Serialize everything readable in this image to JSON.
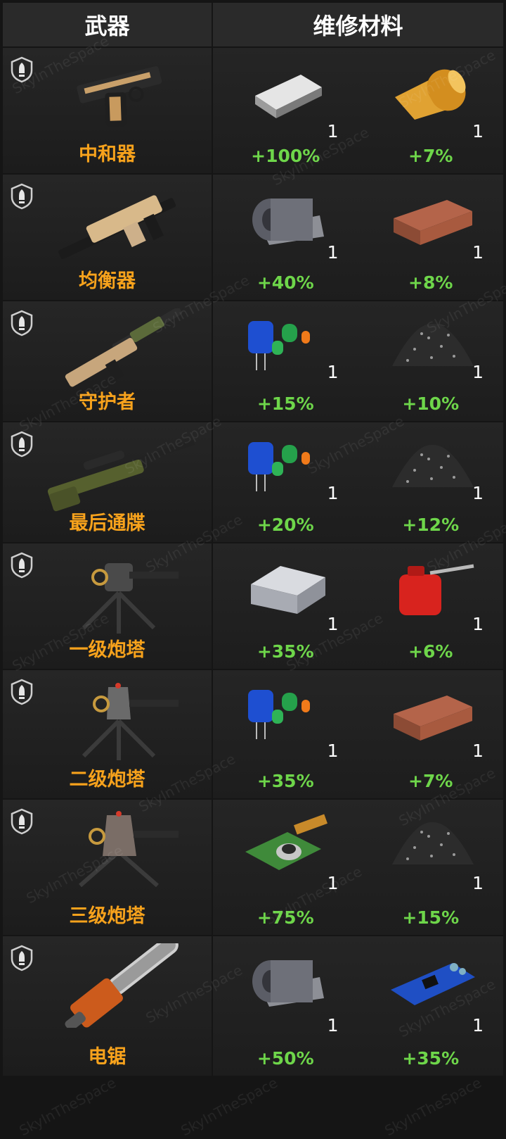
{
  "header": {
    "weapon": "武器",
    "materials": "维修材料"
  },
  "watermark": "SkyInTheSpace",
  "colors": {
    "weapon_name": "#f7a21c",
    "percent": "#6ed64a"
  },
  "rows": [
    {
      "weapon": "中和器",
      "weapon_icon": "pistol-icon",
      "left": {
        "icon": "steel-ingot-icon",
        "qty": "1",
        "pct": "+100%"
      },
      "right": {
        "icon": "gold-foil-roll-icon",
        "qty": "1",
        "pct": "+7%"
      }
    },
    {
      "weapon": "均衡器",
      "weapon_icon": "smg-icon",
      "left": {
        "icon": "metal-sheet-roll-icon",
        "qty": "1",
        "pct": "+40%"
      },
      "right": {
        "icon": "copper-brick-icon",
        "qty": "1",
        "pct": "+8%"
      }
    },
    {
      "weapon": "守护者",
      "weapon_icon": "shotgun-icon",
      "left": {
        "icon": "capacitors-icon",
        "qty": "1",
        "pct": "+15%"
      },
      "right": {
        "icon": "gravel-pile-icon",
        "qty": "1",
        "pct": "+10%"
      }
    },
    {
      "weapon": "最后通牒",
      "weapon_icon": "sniper-rifle-icon",
      "left": {
        "icon": "capacitors-icon",
        "qty": "1",
        "pct": "+20%"
      },
      "right": {
        "icon": "gravel-pile-icon",
        "qty": "1",
        "pct": "+12%"
      }
    },
    {
      "weapon": "一级炮塔",
      "weapon_icon": "turret-lv1-icon",
      "left": {
        "icon": "aluminum-block-icon",
        "qty": "1",
        "pct": "+35%"
      },
      "right": {
        "icon": "oil-can-icon",
        "qty": "1",
        "pct": "+6%"
      }
    },
    {
      "weapon": "二级炮塔",
      "weapon_icon": "turret-lv2-icon",
      "left": {
        "icon": "capacitors-icon",
        "qty": "1",
        "pct": "+35%"
      },
      "right": {
        "icon": "copper-brick-icon",
        "qty": "1",
        "pct": "+7%"
      }
    },
    {
      "weapon": "三级炮塔",
      "weapon_icon": "turret-lv3-icon",
      "left": {
        "icon": "camera-module-icon",
        "qty": "1",
        "pct": "+75%"
      },
      "right": {
        "icon": "gravel-pile-icon",
        "qty": "1",
        "pct": "+15%"
      }
    },
    {
      "weapon": "电锯",
      "weapon_icon": "chainsaw-icon",
      "left": {
        "icon": "metal-sheet-roll-icon",
        "qty": "1",
        "pct": "+50%"
      },
      "right": {
        "icon": "circuit-board-icon",
        "qty": "1",
        "pct": "+35%"
      }
    }
  ]
}
